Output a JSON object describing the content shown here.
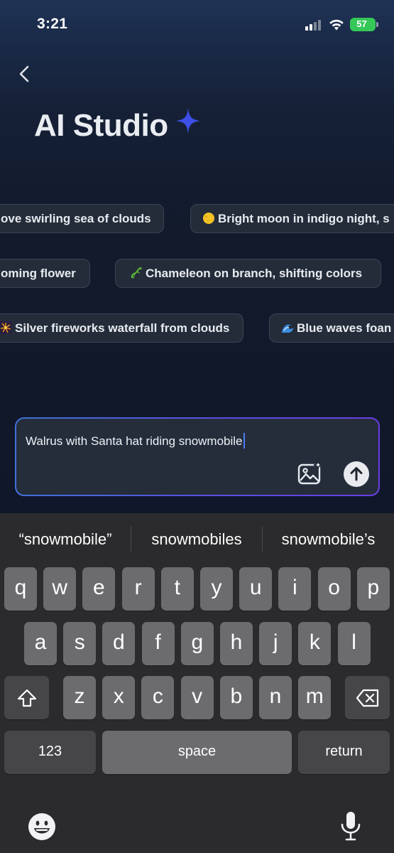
{
  "status_bar": {
    "time": "3:21",
    "battery": "57"
  },
  "header": {
    "title": "AI Studio"
  },
  "chips": [
    {
      "text": "ove swirling sea of clouds",
      "emoji": ""
    },
    {
      "text": "Bright moon in indigo night, s",
      "emoji": "moon-icon"
    },
    {
      "text": "oming flower",
      "emoji": ""
    },
    {
      "text": "Chameleon on branch, shifting colors",
      "emoji": "lizard-icon"
    },
    {
      "text": "Silver fireworks waterfall from clouds",
      "emoji": "fireworks-icon"
    },
    {
      "text": "Blue waves foan",
      "emoji": "wave-icon"
    }
  ],
  "prompt": {
    "value": "Walrus with Santa hat riding snowmobile"
  },
  "keyboard": {
    "suggestions": [
      "“snowmobile”",
      "snowmobiles",
      "snowmobile’s"
    ],
    "row1": [
      "q",
      "w",
      "e",
      "r",
      "t",
      "y",
      "u",
      "i",
      "o",
      "p"
    ],
    "row2": [
      "a",
      "s",
      "d",
      "f",
      "g",
      "h",
      "j",
      "k",
      "l"
    ],
    "row3": [
      "z",
      "x",
      "c",
      "v",
      "b",
      "n",
      "m"
    ],
    "numbers_label": "123",
    "space_label": "space",
    "return_label": "return"
  },
  "colors": {
    "accent": "#3f72d9",
    "accent2": "#6a3ee6",
    "battery": "#36c759"
  }
}
